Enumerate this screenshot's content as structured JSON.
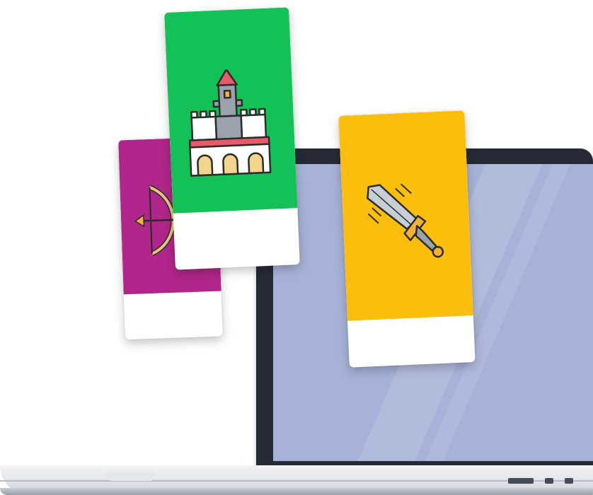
{
  "illustration": {
    "laptop": {
      "screen_color": "#a6b2d7",
      "frame_color": "#252a35"
    },
    "cards": [
      {
        "name": "bow-arrow-card",
        "icon": "bow-and-arrow-icon",
        "color": "#b1268a"
      },
      {
        "name": "castle-card",
        "icon": "castle-icon",
        "color": "#13c157"
      },
      {
        "name": "sword-card",
        "icon": "sword-icon",
        "color": "#fcbe0d"
      }
    ]
  }
}
